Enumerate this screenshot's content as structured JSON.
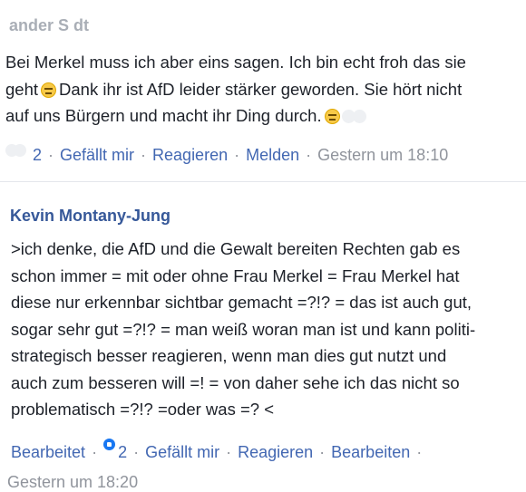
{
  "comments": [
    {
      "author": "ander S    dt",
      "lines": [
        {
          "text": "Bei Merkel  muss ich aber eins sagen. Ich bin echt froh das sie"
        },
        {
          "text": "geht",
          "emoji_after": "unamused-face",
          "rest": "Dank ihr ist AfD leider stärker geworden. Sie hört nicht"
        },
        {
          "text": "auf uns Bürgern und macht ihr Ding durch.",
          "emoji_after": "unamused-face"
        }
      ],
      "actions": {
        "reaction_count": "2",
        "like": "Gefällt mir",
        "react": "Reagieren",
        "report": "Melden",
        "time": "Gestern um 18:10"
      }
    },
    {
      "author": "Kevin Montany-Jung",
      "lines": [
        ">ich denke, die AfD und die Gewalt bereiten Rechten gab es",
        "schon immer = mit oder ohne Frau Merkel = Frau Merkel hat",
        "diese nur erkennbar sichtbar gemacht =?!? = das ist auch gut,",
        "sogar sehr gut =?!? = man weiß  woran man ist und kann politi-",
        "strategisch besser reagieren,  wenn man dies gut nutzt und",
        "auch zum besseren will =! = von daher sehe ich das nicht so",
        "problematisch =?!? =oder was =? <"
      ],
      "actions": {
        "edited": "Bearbeitet",
        "reaction_count": "2",
        "like": "Gefällt mir",
        "react": "Reagieren",
        "edit": "Bearbeiten",
        "time": "Gestern um 18:20"
      }
    }
  ],
  "colors": {
    "link": "#4267b2",
    "author": "#365899",
    "meta": "#90949c",
    "text": "#1d2129",
    "like_badge": "#1877f2"
  },
  "icons": {
    "emoji": "unamused-face-icon",
    "like_badge": "like-reaction-icon"
  }
}
